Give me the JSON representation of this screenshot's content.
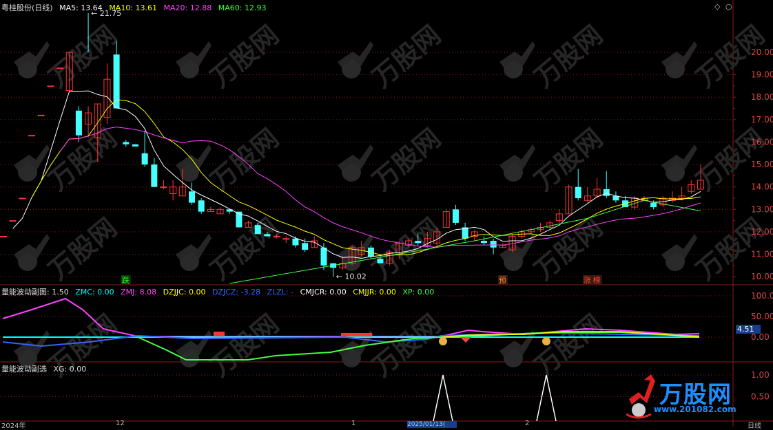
{
  "main_panel": {
    "stock_title": "粤桂股份(日线)",
    "ma": [
      {
        "label": "MA5: 13.64",
        "color": "#ffffff"
      },
      {
        "label": "MA10: 13.61",
        "color": "#ffff00"
      },
      {
        "label": "MA20: 12.88",
        "color": "#ff44ff"
      },
      {
        "label": "MA60: 12.93",
        "color": "#44ff44"
      }
    ],
    "high_label": "21.75",
    "low_label": "10.02",
    "price_axis": [
      "20.00",
      "19.00",
      "18.00",
      "17.00",
      "16.00",
      "15.00",
      "14.00",
      "13.00",
      "12.00",
      "11.00",
      "10.00"
    ],
    "signals": [
      {
        "text": "跌",
        "color": "#22ff22"
      },
      {
        "text": "预",
        "color": "#ff8844"
      },
      {
        "text": "涨",
        "color": "#ff4444"
      },
      {
        "text": "榜",
        "color": "#ff4444"
      }
    ]
  },
  "panel2": {
    "title": "量能波动副图",
    "items": [
      {
        "label": ": 1.50",
        "color": "#dddddd"
      },
      {
        "label": "ZMC: 0.00",
        "color": "#00ffff"
      },
      {
        "label": "ZMJ: 8.08",
        "color": "#ff44ff"
      },
      {
        "label": "DZJJC: 0.00",
        "color": "#ffff00"
      },
      {
        "label": "DZJCZ: -3.28",
        "color": "#3366ff"
      },
      {
        "label": "ZLZL: -",
        "color": "#3366ff"
      },
      {
        "label": "CMJCR: 0.00",
        "color": "#ffffff"
      },
      {
        "label": "CMJJR: 0.00",
        "color": "#ffff00"
      },
      {
        "label": "XP: 0.00",
        "color": "#44ff44"
      }
    ],
    "axis": [
      "100.0",
      "50.00",
      "0.00"
    ],
    "current_value": "4.51"
  },
  "panel3": {
    "title": "量能波动副选",
    "xg": "XG: 0.00",
    "axis": [
      "1.00",
      "0.50"
    ]
  },
  "bottom": {
    "labels": [
      "2024年",
      "12",
      "1",
      "2"
    ],
    "date_badge": "2025/01/13(",
    "period": "日线"
  },
  "watermark_text": "万股网",
  "logo": {
    "text": "万股网",
    "url": "www.201082.com"
  },
  "colors": {
    "up": "#ff3333",
    "down": "#44ffff",
    "grid": "#8b1a1a"
  },
  "chart_data": {
    "type": "candlestick",
    "ohlc": [
      [
        11.8,
        11.8,
        11.8,
        11.8
      ],
      [
        12.5,
        12.5,
        12.5,
        12.5
      ],
      [
        13.5,
        13.5,
        13.5,
        13.5
      ],
      [
        16.3,
        16.3,
        16.3,
        16.3
      ],
      [
        17.2,
        17.2,
        17.2,
        17.2
      ],
      [
        18.5,
        18.5,
        18.5,
        18.5
      ],
      [
        19.3,
        19.3,
        19.3,
        19.3
      ],
      [
        18.3,
        20.0,
        18.3,
        20.0
      ],
      [
        17.4,
        16.3,
        17.6,
        16.0
      ],
      [
        16.8,
        17.3,
        17.6,
        16.2
      ],
      [
        16.2,
        17.7,
        17.7,
        15.1
      ],
      [
        17.1,
        18.8,
        19.5,
        16.8
      ],
      [
        19.9,
        17.5,
        20.5,
        17.5
      ],
      [
        16.0,
        15.9,
        16.1,
        15.8
      ],
      [
        15.9,
        15.8,
        15.9,
        15.8
      ],
      [
        15.5,
        15.0,
        16.5,
        14.9
      ],
      [
        15.0,
        14.0,
        15.3,
        14.0
      ],
      [
        14.0,
        14.0,
        14.3,
        13.9
      ],
      [
        13.7,
        14.0,
        14.3,
        13.4
      ],
      [
        13.6,
        14.0,
        14.8,
        13.6
      ],
      [
        13.8,
        13.3,
        14.2,
        13.2
      ],
      [
        13.4,
        12.9,
        13.5,
        12.8
      ],
      [
        12.9,
        13.0,
        13.1,
        12.9
      ],
      [
        12.8,
        13.0,
        13.1,
        12.8
      ],
      [
        13.0,
        12.9,
        13.0,
        12.8
      ],
      [
        12.9,
        12.2,
        12.9,
        12.2
      ],
      [
        12.2,
        12.4,
        12.5,
        12.2
      ],
      [
        12.3,
        11.9,
        12.4,
        11.9
      ],
      [
        11.9,
        11.8,
        12.0,
        11.8
      ],
      [
        11.8,
        11.8,
        11.9,
        11.7
      ],
      [
        11.7,
        11.7,
        11.8,
        11.5
      ],
      [
        11.7,
        11.4,
        11.8,
        11.3
      ],
      [
        11.5,
        11.2,
        11.7,
        11.1
      ],
      [
        11.3,
        11.6,
        11.8,
        11.3
      ],
      [
        11.3,
        10.5,
        11.5,
        10.3
      ],
      [
        10.6,
        10.4,
        10.6,
        10.0
      ],
      [
        10.4,
        10.6,
        10.9,
        10.3
      ],
      [
        10.6,
        11.3,
        11.4,
        10.5
      ],
      [
        11.0,
        11.3,
        11.6,
        10.9
      ],
      [
        11.3,
        10.9,
        11.4,
        10.8
      ],
      [
        10.8,
        10.6,
        10.9,
        10.6
      ],
      [
        10.6,
        11.1,
        11.2,
        10.5
      ],
      [
        11.0,
        11.5,
        11.6,
        10.8
      ],
      [
        11.4,
        11.6,
        11.7,
        11.3
      ],
      [
        11.6,
        11.5,
        11.9,
        11.4
      ],
      [
        11.4,
        11.7,
        12.0,
        11.3
      ],
      [
        11.5,
        12.0,
        12.2,
        11.4
      ],
      [
        12.2,
        12.9,
        13.0,
        12.2
      ],
      [
        13.0,
        12.4,
        13.2,
        12.3
      ],
      [
        12.2,
        11.7,
        12.4,
        11.6
      ],
      [
        11.8,
        12.0,
        12.1,
        11.6
      ],
      [
        11.6,
        11.5,
        11.8,
        11.4
      ],
      [
        11.6,
        11.3,
        11.7,
        11.0
      ],
      [
        11.3,
        11.4,
        11.5,
        11.3
      ],
      [
        11.2,
        11.8,
        11.9,
        11.1
      ],
      [
        11.8,
        12.0,
        12.1,
        11.7
      ],
      [
        12.0,
        12.1,
        12.2,
        11.9
      ],
      [
        12.1,
        12.2,
        12.4,
        12.0
      ],
      [
        12.2,
        12.4,
        12.5,
        12.1
      ],
      [
        12.5,
        12.8,
        13.0,
        12.4
      ],
      [
        12.8,
        14.0,
        14.1,
        12.8
      ],
      [
        14.0,
        13.5,
        14.8,
        13.4
      ],
      [
        13.4,
        13.6,
        14.0,
        13.3
      ],
      [
        13.6,
        13.9,
        14.4,
        13.5
      ],
      [
        13.9,
        13.6,
        14.7,
        13.5
      ],
      [
        13.6,
        13.4,
        13.8,
        13.3
      ],
      [
        13.4,
        13.1,
        13.6,
        13.1
      ],
      [
        13.1,
        13.5,
        13.6,
        13.0
      ],
      [
        13.4,
        13.5,
        13.6,
        13.4
      ],
      [
        13.3,
        13.1,
        13.4,
        13.0
      ],
      [
        13.2,
        13.5,
        13.6,
        13.1
      ],
      [
        13.4,
        13.5,
        13.8,
        13.3
      ],
      [
        13.5,
        13.6,
        14.0,
        13.4
      ],
      [
        13.8,
        14.1,
        14.3,
        13.7
      ],
      [
        13.9,
        14.3,
        15.0,
        13.9
      ]
    ],
    "ylim": [
      9.7,
      21.9
    ]
  }
}
